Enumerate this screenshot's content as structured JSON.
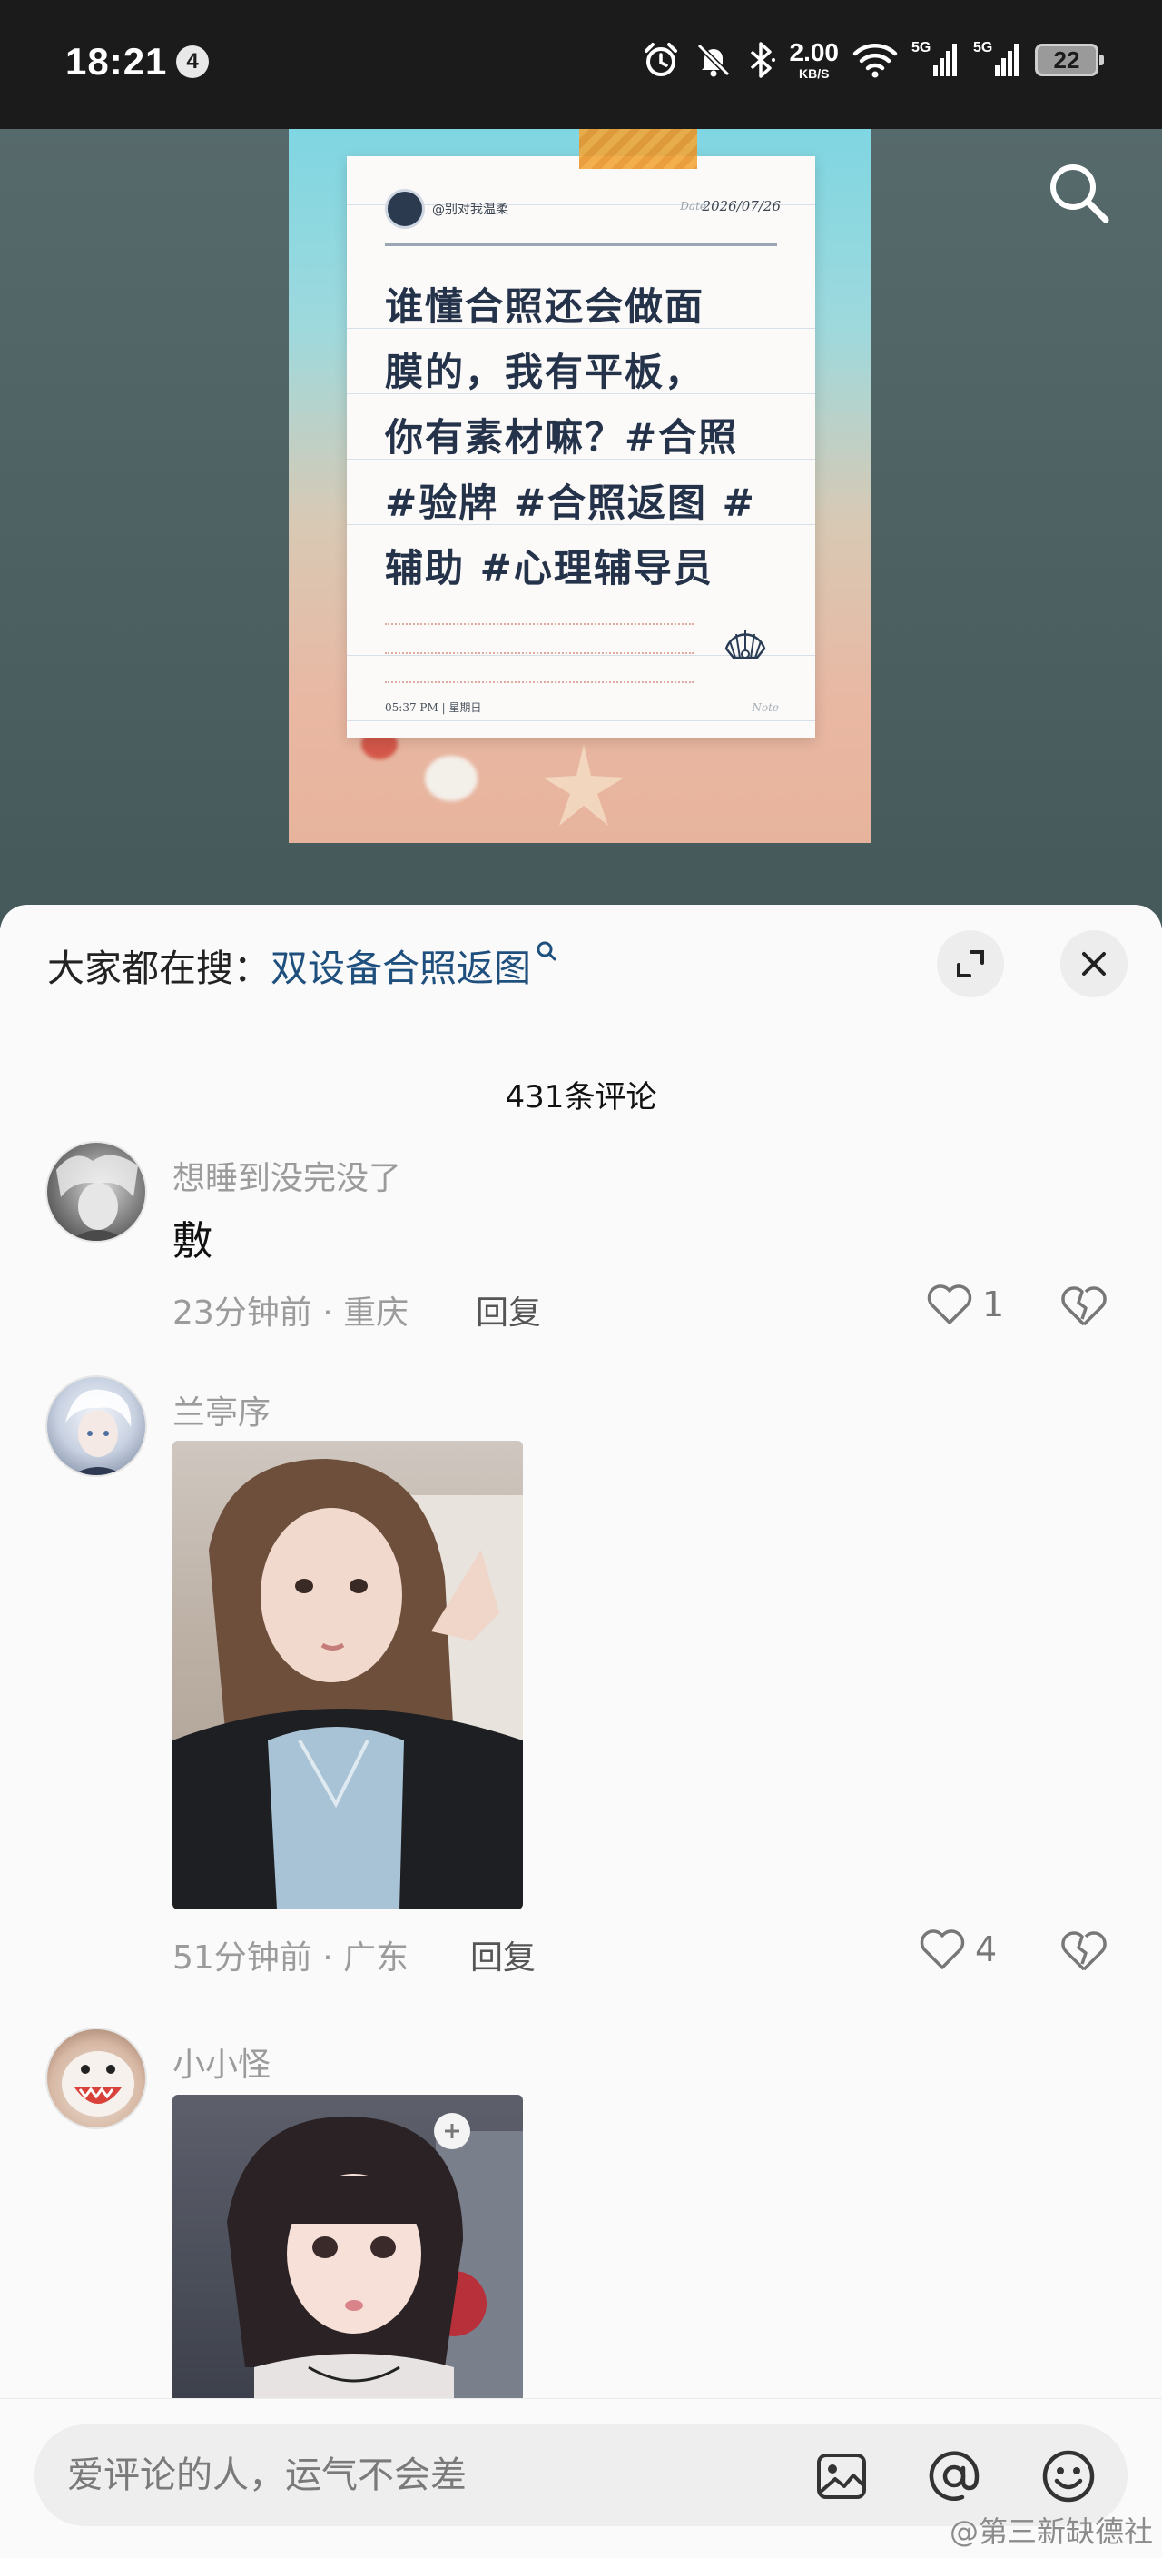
{
  "status_bar": {
    "time": "18:21",
    "notification_count": "4",
    "net_speed_value": "2.00",
    "net_speed_unit": "KB/S",
    "signal_1_label": "5G",
    "signal_2_label": "5G",
    "battery": "22"
  },
  "post": {
    "note_handle": "@别对我温柔",
    "note_date_label": "Date",
    "note_date": "2026/07/26",
    "note_line_1": "谁懂合照还会做面",
    "note_line_2": "膜的，我有平板，",
    "note_line_3": "你有素材嘛？#合照",
    "note_line_4": "#验牌 #合照返图 #",
    "note_line_5": "辅助 #心理辅导员",
    "note_footer_left": "05:37 PM  |  星期日",
    "note_footer_right": "Note"
  },
  "sheet": {
    "suggest_prefix": "大家都在搜：",
    "suggest_term": "双设备合照返图",
    "comment_count_title": "431条评论"
  },
  "comments": [
    {
      "username": "想睡到没完没了",
      "text": "敷",
      "meta": "23分钟前 · 重庆",
      "reply_label": "回复",
      "likes": "1"
    },
    {
      "username": "兰亭序",
      "meta": "51分钟前 · 广东",
      "reply_label": "回复",
      "likes": "4"
    },
    {
      "username": "小小怪"
    }
  ],
  "input_bar": {
    "placeholder": "爱评论的人，运气不会差"
  },
  "watermark": "@第三新缺德社",
  "colors": {
    "accent_link": "#1e4f7d",
    "status_bar_bg": "#1b1b1b",
    "post_bg": "#4f6264"
  }
}
